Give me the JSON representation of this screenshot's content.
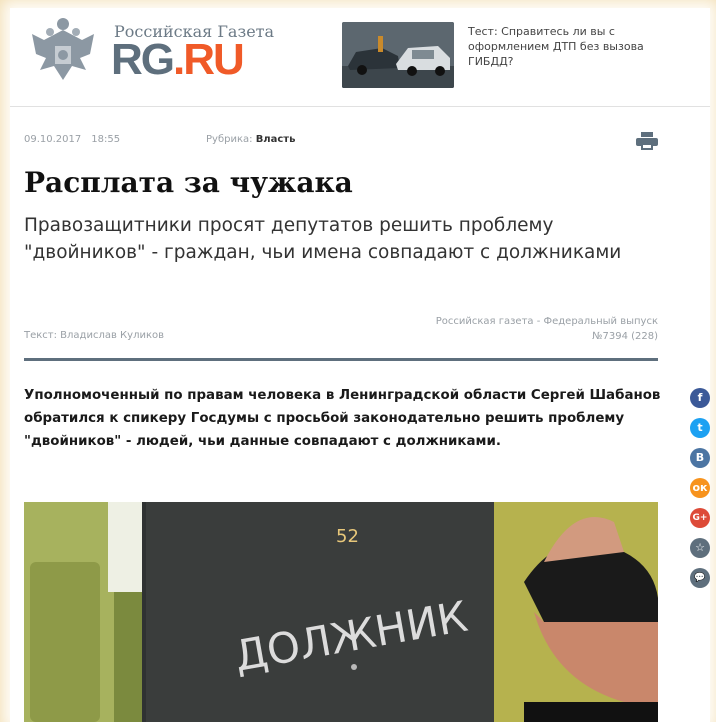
{
  "header": {
    "brand_top": "Российская Газета",
    "brand_rg": "RG",
    "brand_dot": ".",
    "brand_ru": "RU",
    "promo_text": "Тест: Справитесь ли вы с оформлением ДТП без вызова ГИБДД?"
  },
  "article": {
    "date": "09.10.2017",
    "time": "18:55",
    "rubric_label": "Рубрика:",
    "rubric_value": "Власть",
    "title": "Расплата за чужака",
    "subtitle": "Правозащитники просят депутатов решить проблему \"двойников\" - граждан, чьи имена совпадают с должниками",
    "source_line1": "Российская газета - Федеральный выпуск",
    "source_line2": "№7394 (228)",
    "author": "Текст: Владислав Куликов",
    "lead": "Уполномоченный по правам человека в Ленинградской области Сергей Шабанов обратился к спикеру Госдумы с просьбой законодательно решить проблему \"двойников\" - людей, чьи данные совпадают с должниками.",
    "photo": {
      "door_number": "52",
      "door_word": "ДОЛЖНИК"
    }
  },
  "social": {
    "facebook": "f",
    "twitter": "t",
    "vk": "В",
    "odnoklassniki": "ок",
    "google": "G+",
    "bookmark": "☆",
    "comment": "💬"
  },
  "colors": {
    "accent": "#f05a28",
    "brand_gray": "#5e6f7d",
    "background": "#f3dfb4"
  }
}
